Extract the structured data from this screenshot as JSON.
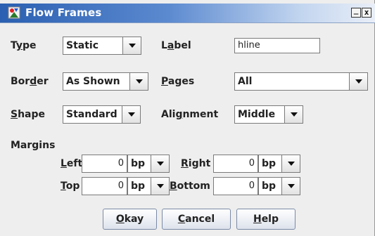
{
  "window": {
    "title": "Flow Frames",
    "icon": "app-icon",
    "minimize_label": "_",
    "close_label": "x"
  },
  "fields": {
    "type": {
      "label_pre": "T",
      "label_u": "y",
      "label_post": "pe",
      "value": "Static"
    },
    "label": {
      "label_pre": "L",
      "label_u": "a",
      "label_post": "bel",
      "value": "hline"
    },
    "border": {
      "label_pre": "Bor",
      "label_u": "d",
      "label_post": "er",
      "value": "As Shown"
    },
    "pages": {
      "label_pre": "",
      "label_u": "P",
      "label_post": "ages",
      "value": "All"
    },
    "shape": {
      "label_pre": "",
      "label_u": "S",
      "label_post": "hape",
      "value": "Standard"
    },
    "alignment": {
      "label_pre": "Ali",
      "label_u": "g",
      "label_post": "nment",
      "value": "Middle"
    }
  },
  "margins": {
    "heading": "Margins",
    "left": {
      "label_u": "L",
      "label_post": "eft",
      "value": "0",
      "unit": "bp"
    },
    "right": {
      "label_u": "R",
      "label_post": "ight",
      "value": "0",
      "unit": "bp"
    },
    "top": {
      "label_u": "T",
      "label_post": "op",
      "value": "0",
      "unit": "bp"
    },
    "bottom": {
      "label_u": "B",
      "label_post": "ottom",
      "value": "0",
      "unit": "bp"
    }
  },
  "buttons": {
    "okay": {
      "label_u": "O",
      "label_post": "kay"
    },
    "cancel": {
      "label_u": "C",
      "label_post": "ancel"
    },
    "help": {
      "label_u": "H",
      "label_post": "elp"
    }
  },
  "colors": {
    "titlebar_start": "#2a5fb1",
    "titlebar_end": "#e9eef7",
    "dialog_bg": "#eeeeee"
  }
}
